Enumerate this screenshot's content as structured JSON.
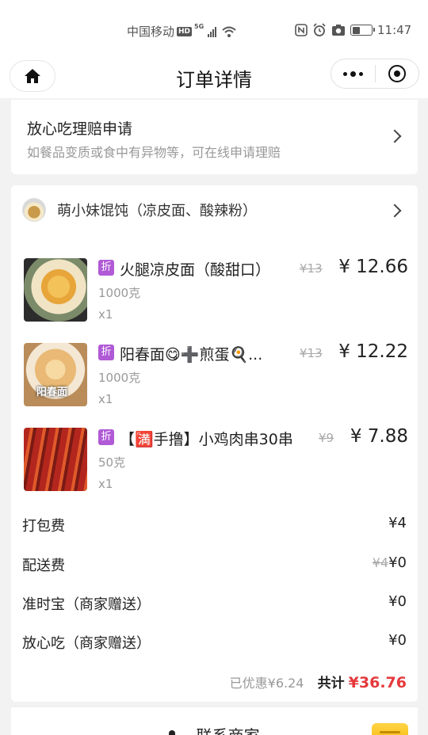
{
  "status_bar": {
    "carrier": "中国移动",
    "hd": "HD",
    "network": "5G",
    "time": "11:47"
  },
  "nav": {
    "title": "订单详情"
  },
  "claim": {
    "title": "放心吃理赔申请",
    "subtitle": "如餐品变质或食中有异物等，可在线申请理赔"
  },
  "shop": {
    "name": "萌小妹馄饨（凉皮面、酸辣粉）"
  },
  "items": [
    {
      "name": "火腿凉皮面（酸甜口）",
      "discount_tag": "折",
      "weight": "1000克",
      "qty": "x1",
      "original_price": "¥13",
      "price": "¥ 12.66"
    },
    {
      "name": "阳春面😋➕煎蛋🍳...",
      "discount_tag": "折",
      "weight": "1000克",
      "qty": "x1",
      "original_price": "¥13",
      "price": "¥ 12.22",
      "thumb_caption": "阳春面"
    },
    {
      "name": "【🈵手撸】小鸡肉串30串",
      "discount_tag": "折",
      "weight": "50克",
      "qty": "x1",
      "original_price": "¥9",
      "price": "¥ 7.88"
    }
  ],
  "fees": [
    {
      "label": "打包费",
      "value": "¥4"
    },
    {
      "label": "配送费",
      "original": "¥4",
      "value": "¥0"
    },
    {
      "label": "准时宝（商家赠送）",
      "value": "¥0"
    },
    {
      "label": "放心吃（商家赠送）",
      "value": "¥0"
    }
  ],
  "summary": {
    "saved": "已优惠¥6.24",
    "total_label": "共计",
    "total": "¥36.76"
  },
  "contact": {
    "label": "联系商家"
  },
  "colors": {
    "accent_red": "#e4393c",
    "discount_purple": "#b05ad6"
  }
}
